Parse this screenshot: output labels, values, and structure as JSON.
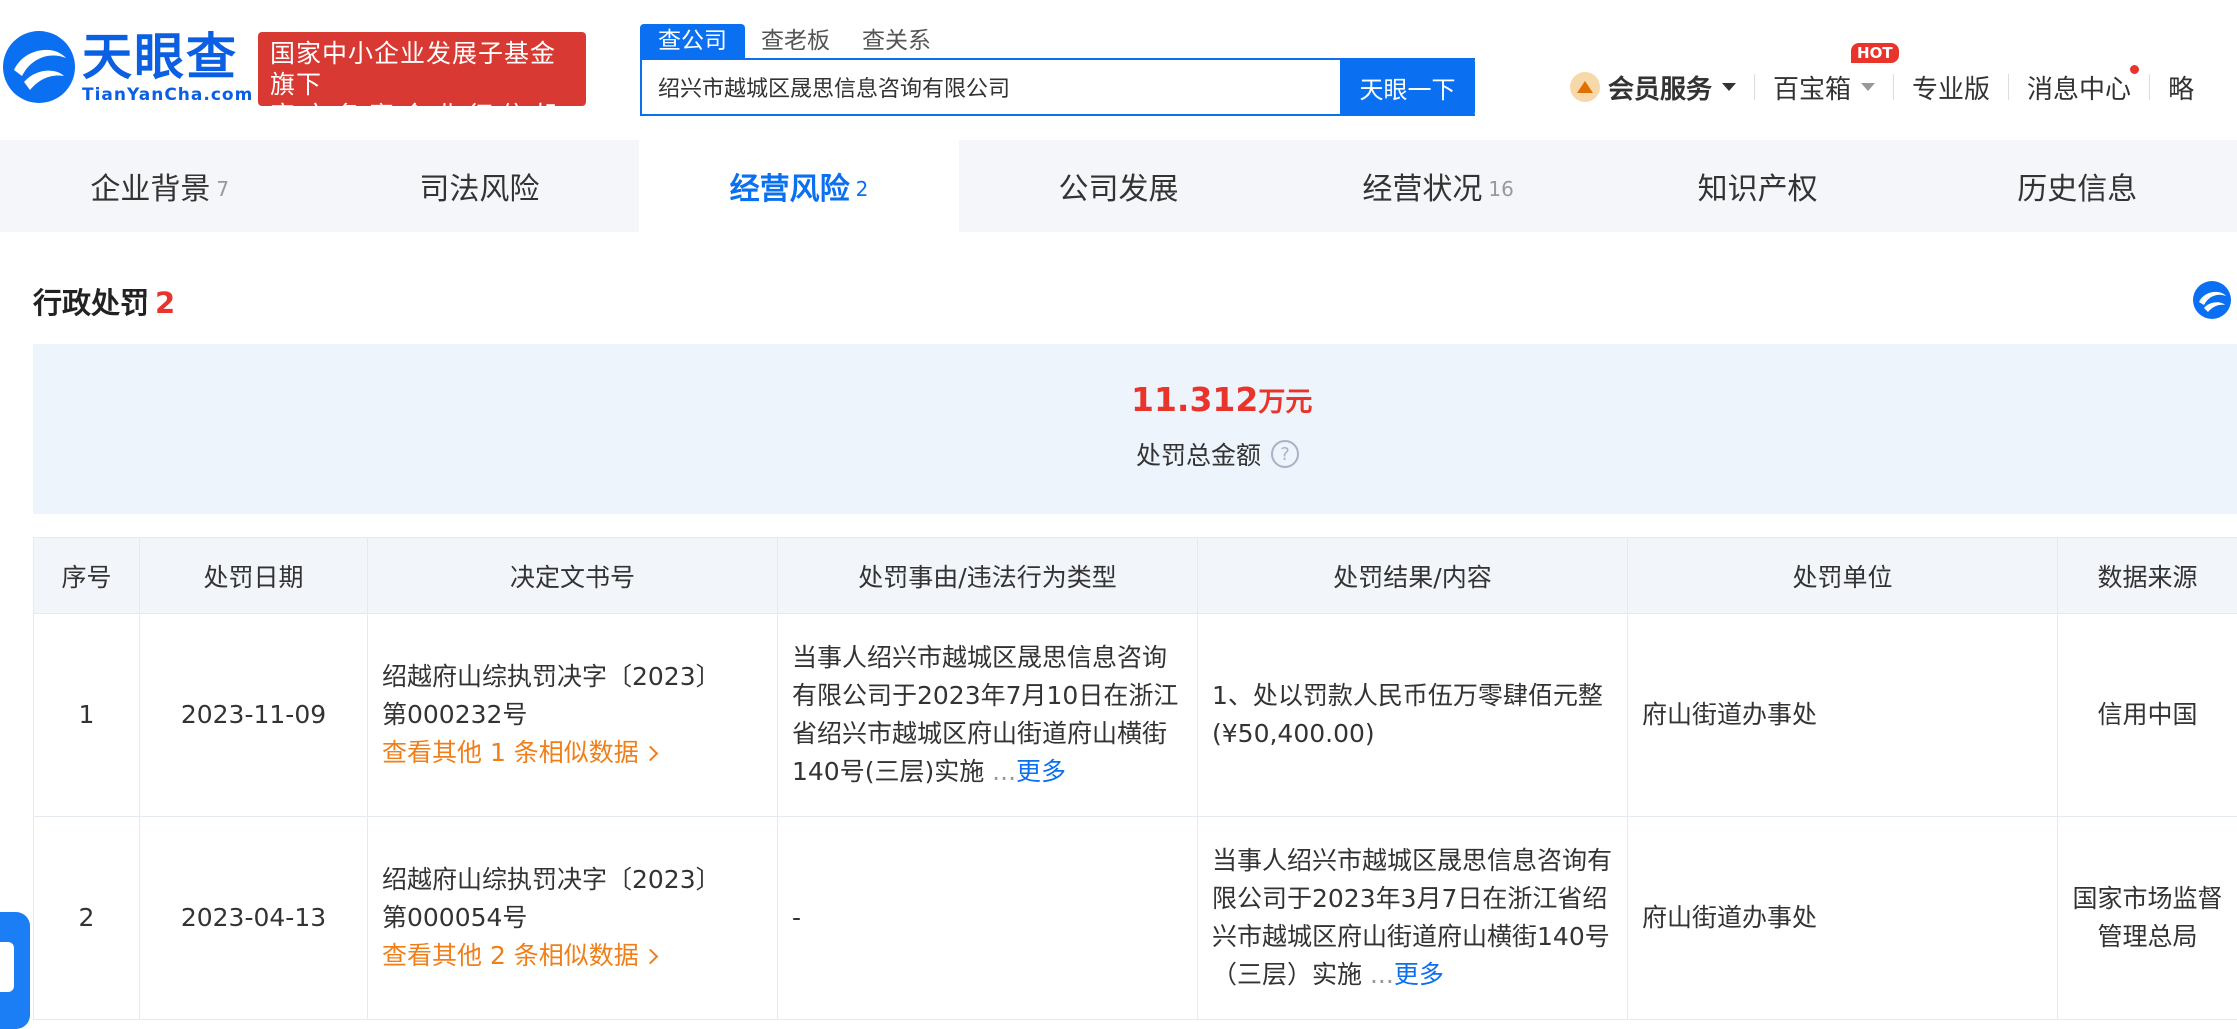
{
  "brand": {
    "name_cn": "天眼查",
    "name_en": "TianYanCha.com",
    "badge_line1": "国家中小企业发展子基金旗下",
    "badge_line2": "官方备案企业征信机构",
    "color": "#0b5fe2"
  },
  "search": {
    "tabs": [
      {
        "label": "查公司",
        "active": true
      },
      {
        "label": "查老板",
        "active": false
      },
      {
        "label": "查关系",
        "active": false
      }
    ],
    "value": "绍兴市越城区晟思信息咨询有限公司",
    "button": "天眼一下"
  },
  "topnav": {
    "vip": "会员服务",
    "toolbox": "百宝箱",
    "hot": "HOT",
    "pro": "专业版",
    "messages": "消息中心",
    "more": "略"
  },
  "section_tabs": [
    {
      "label": "企业背景",
      "count": "7",
      "active": false
    },
    {
      "label": "司法风险",
      "count": "",
      "active": false
    },
    {
      "label": "经营风险",
      "count": "2",
      "active": true
    },
    {
      "label": "公司发展",
      "count": "",
      "active": false
    },
    {
      "label": "经营状况",
      "count": "16",
      "active": false
    },
    {
      "label": "知识产权",
      "count": "",
      "active": false
    },
    {
      "label": "历史信息",
      "count": "",
      "active": false
    }
  ],
  "section": {
    "title": "行政处罚",
    "count": "2",
    "summary_amount": "11.312",
    "summary_unit": "万元",
    "summary_label": "处罚总金额",
    "help": "?"
  },
  "table": {
    "headers": [
      "序号",
      "处罚日期",
      "决定文书号",
      "处罚事由/违法行为类型",
      "处罚结果/内容",
      "处罚单位",
      "数据来源"
    ],
    "rows": [
      {
        "no": "1",
        "date": "2023-11-09",
        "doc_line1": "绍越府山综执罚决字〔2023〕",
        "doc_line2": "第000232号",
        "similar": "查看其他 1 条相似数据",
        "reason": "当事人绍兴市越城区晟思信息咨询有限公司于2023年7月10日在浙江省绍兴市越城区府山街道府山横街140号(三层)实施",
        "reason_more": "更多",
        "result": "1、处以罚款人民币伍万零肆佰元整(¥50,400.00)",
        "unit": "府山街道办事处",
        "source": "信用中国"
      },
      {
        "no": "2",
        "date": "2023-04-13",
        "doc_line1": "绍越府山综执罚决字〔2023〕",
        "doc_line2": "第000054号",
        "similar": "查看其他 2 条相似数据",
        "reason": "-",
        "result": "当事人绍兴市越城区晟思信息咨询有限公司于2023年3月7日在浙江省绍兴市越城区府山街道府山横街140号（三层）实施",
        "result_more": "更多",
        "unit": "府山街道办事处",
        "source": "国家市场监督管理总局"
      }
    ]
  }
}
